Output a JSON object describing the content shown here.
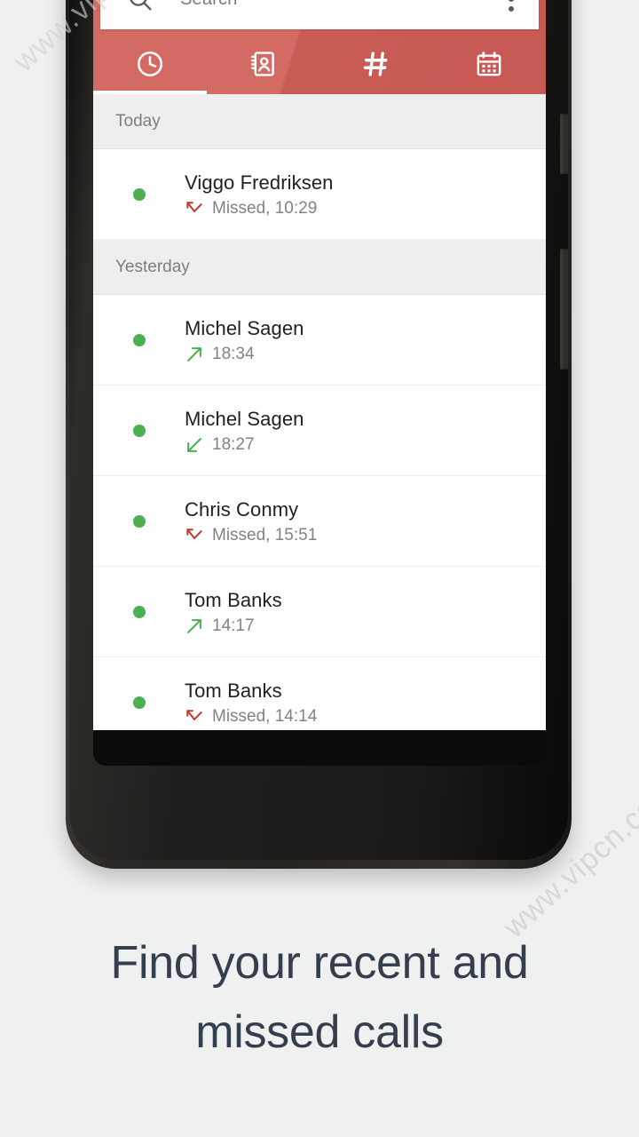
{
  "app": {
    "accent_color": "#d15f58",
    "presence_color": "#4caf50",
    "missed_color": "#c0392b",
    "caption_color": "#333f4d"
  },
  "search": {
    "placeholder": "Search",
    "value": "",
    "icon": "search-icon",
    "overflow_icon": "more-vert-icon"
  },
  "tabs": [
    {
      "id": "recents",
      "icon": "clock-icon",
      "label": "Recents",
      "active": true
    },
    {
      "id": "contacts",
      "icon": "contacts-icon",
      "label": "Contacts",
      "active": false
    },
    {
      "id": "dialpad",
      "icon": "hash-icon",
      "label": "Dialpad",
      "active": false
    },
    {
      "id": "calendar",
      "icon": "calendar-icon",
      "label": "Calendar",
      "active": false
    }
  ],
  "call_log": [
    {
      "section": "Today",
      "rows": [
        {
          "name": "Viggo Fredriksen",
          "type": "missed",
          "icon": "call-missed-icon",
          "meta": "Missed, 10:29"
        }
      ]
    },
    {
      "section": "Yesterday",
      "rows": [
        {
          "name": "Michel Sagen",
          "type": "outgoing",
          "icon": "call-made-icon",
          "meta": "18:34"
        },
        {
          "name": "Michel Sagen",
          "type": "incoming",
          "icon": "call-received-icon",
          "meta": "18:27"
        },
        {
          "name": "Chris Conmy",
          "type": "missed",
          "icon": "call-missed-icon",
          "meta": "Missed, 15:51"
        },
        {
          "name": "Tom Banks",
          "type": "outgoing",
          "icon": "call-made-icon",
          "meta": "14:17"
        },
        {
          "name": "Tom Banks",
          "type": "missed",
          "icon": "call-missed-icon",
          "meta": "Missed, 14:14"
        }
      ]
    }
  ],
  "caption": {
    "line1": "Find your recent and",
    "line2": "missed calls"
  },
  "watermark": {
    "text": "www.vipcn.com"
  }
}
